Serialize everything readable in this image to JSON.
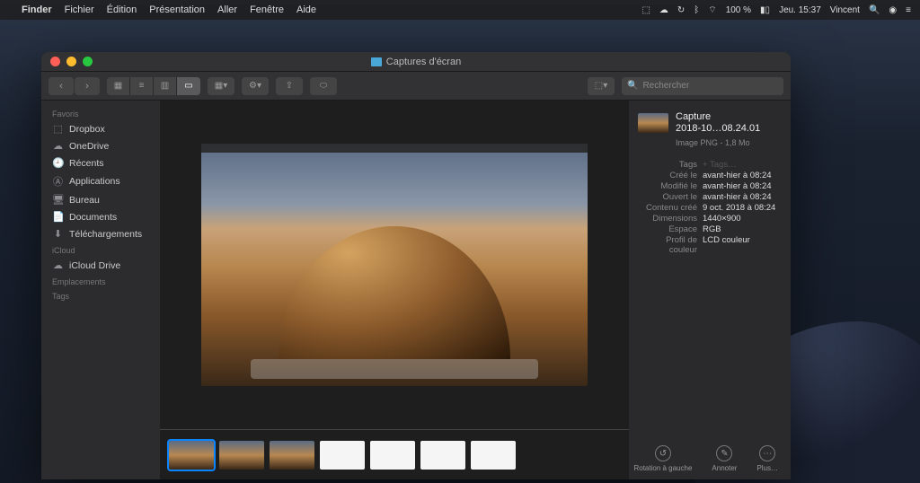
{
  "menubar": {
    "app": "Finder",
    "items": [
      "Fichier",
      "Édition",
      "Présentation",
      "Aller",
      "Fenêtre",
      "Aide"
    ],
    "status": {
      "battery": "100 %",
      "time": "Jeu. 15:37",
      "user": "Vincent"
    }
  },
  "window": {
    "title": "Captures d'écran",
    "search_placeholder": "Rechercher"
  },
  "sidebar": {
    "sections": [
      {
        "label": "Favoris",
        "items": [
          {
            "icon": "⬚",
            "label": "Dropbox"
          },
          {
            "icon": "☁",
            "label": "OneDrive"
          },
          {
            "icon": "🕘",
            "label": "Récents"
          },
          {
            "icon": "Ⓐ",
            "label": "Applications"
          },
          {
            "icon": "🖥",
            "label": "Bureau"
          },
          {
            "icon": "📄",
            "label": "Documents"
          },
          {
            "icon": "⬇",
            "label": "Téléchargements"
          }
        ]
      },
      {
        "label": "iCloud",
        "items": [
          {
            "icon": "☁",
            "label": "iCloud Drive"
          }
        ]
      },
      {
        "label": "Emplacements",
        "items": []
      },
      {
        "label": "Tags",
        "items": []
      }
    ]
  },
  "file": {
    "name_line1": "Capture",
    "name_line2": "2018-10…08.24.01",
    "kind": "Image PNG - 1,8 Mo",
    "meta": [
      {
        "k": "Tags",
        "v": "+ Tags…",
        "tag": true
      },
      {
        "k": "Créé le",
        "v": "avant-hier à 08:24"
      },
      {
        "k": "Modifié le",
        "v": "avant-hier à 08:24"
      },
      {
        "k": "Ouvert le",
        "v": "avant-hier à 08:24"
      },
      {
        "k": "Contenu créé",
        "v": "9 oct. 2018 à 08:24"
      },
      {
        "k": "Dimensions",
        "v": "1440×900"
      },
      {
        "k": "Espace",
        "v": "RGB"
      },
      {
        "k": "Profil de couleur",
        "v": "LCD couleur"
      }
    ]
  },
  "actions": [
    {
      "icon": "↺",
      "label": "Rotation à gauche"
    },
    {
      "icon": "✎",
      "label": "Annoter"
    },
    {
      "icon": "⋯",
      "label": "Plus…"
    }
  ],
  "thumbs_count": 7
}
